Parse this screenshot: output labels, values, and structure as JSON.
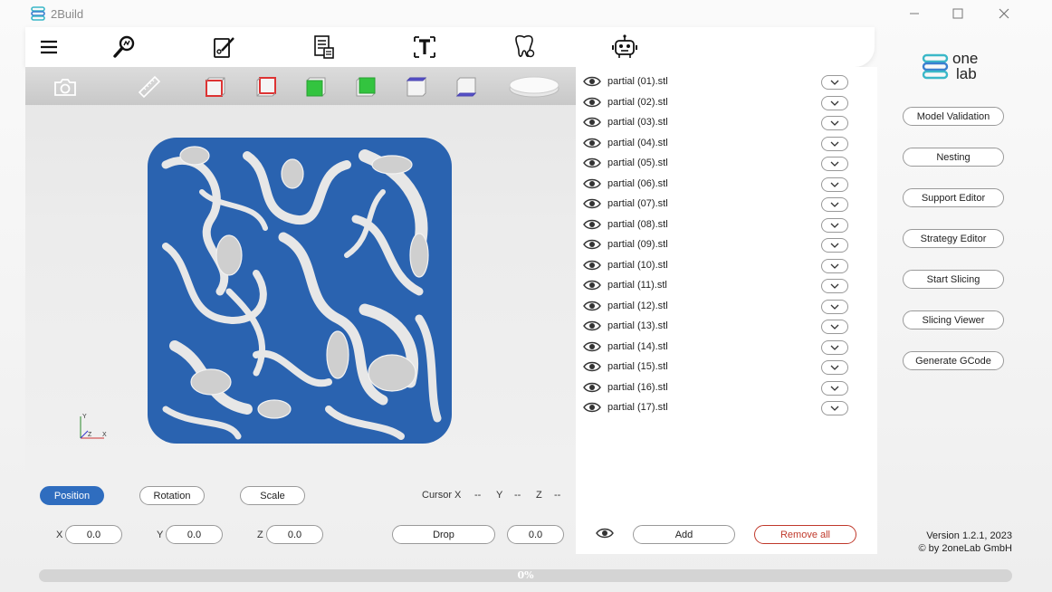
{
  "app": {
    "title": "2Build",
    "brand_line1": "one",
    "brand_line2": "lab"
  },
  "window": {
    "minimize_icon": "minimize-icon",
    "maximize_icon": "maximize-icon",
    "close_icon": "close-icon"
  },
  "toolbar": {
    "items": [
      "menu-icon",
      "analyze-icon",
      "edit-model-icon",
      "report-icon",
      "text-icon",
      "tooth-icon",
      "robot-icon"
    ]
  },
  "view_toolbar": {
    "items": [
      "camera-icon",
      "ruler-icon",
      "view-front-icon",
      "view-back-icon",
      "view-top-icon",
      "view-bottom-icon",
      "view-left-icon",
      "view-right-icon",
      "platform-icon"
    ]
  },
  "transform": {
    "modes": [
      "Position",
      "Rotation",
      "Scale"
    ],
    "active_mode": "Position",
    "cursor_label": "Cursor X",
    "cursor_x": "--",
    "cursor_y_label": "Y",
    "cursor_y": "--",
    "cursor_z_label": "Z",
    "cursor_z": "--",
    "x_label": "X",
    "x_value": "0.0",
    "y_label": "Y",
    "y_value": "0.0",
    "z_label": "Z",
    "z_value": "0.0",
    "drop_label": "Drop",
    "drop_value": "0.0"
  },
  "files": {
    "items": [
      "partial (01).stl",
      "partial (02).stl",
      "partial (03).stl",
      "partial (04).stl",
      "partial (05).stl",
      "partial (06).stl",
      "partial (07).stl",
      "partial (08).stl",
      "partial (09).stl",
      "partial (10).stl",
      "partial (11).stl",
      "partial (12).stl",
      "partial (13).stl",
      "partial (14).stl",
      "partial (15).stl",
      "partial (16).stl",
      "partial (17).stl"
    ],
    "add_label": "Add",
    "remove_all_label": "Remove all"
  },
  "side_buttons": [
    "Model Validation",
    "Nesting",
    "Support Editor",
    "Strategy Editor",
    "Start Slicing",
    "Slicing Viewer",
    "Generate GCode"
  ],
  "version": {
    "line1": "Version 1.2.1, 2023",
    "line2": "© by 2oneLab GmbH"
  },
  "progress": {
    "value": 0,
    "label": "0%"
  },
  "colors": {
    "accent": "#2f6dbf",
    "plate": "#2a63b0",
    "remove": "#c0392b"
  }
}
